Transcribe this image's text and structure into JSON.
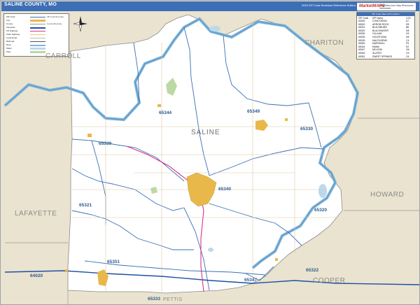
{
  "header": {
    "title": "SALINE COUNTY, MO",
    "edition": "2020 ZIP Code Business Reference Edition",
    "brand": "MarketMAPS",
    "brand_sub": "MapSales.com Map Resources Worldwide"
  },
  "legend": {
    "rows": [
      {
        "label": "ZIP Code",
        "color": "#3a70b3",
        "note": "ZIP Code Boundary"
      },
      {
        "label": "City",
        "color": "#e8b84a",
        "note": ""
      },
      {
        "label": "County",
        "color": "#999999",
        "note": "County Boundary"
      },
      {
        "label": "Interstate",
        "color": "#1f4fa5",
        "note": ""
      },
      {
        "label": "US Highway",
        "color": "#d6338f",
        "note": ""
      },
      {
        "label": "State Highway",
        "color": "#f0c27a",
        "note": ""
      },
      {
        "label": "Local Road",
        "color": "#bbbbbb",
        "note": ""
      },
      {
        "label": "Railroad",
        "color": "#555555",
        "note": ""
      },
      {
        "label": "River",
        "color": "#7fb4d9",
        "note": ""
      },
      {
        "label": "Water",
        "color": "#bcd8ec",
        "note": ""
      },
      {
        "label": "Park",
        "color": "#bcd9a3",
        "note": ""
      }
    ]
  },
  "zip_index": {
    "title": "ZIP Code Index with Location",
    "headers": {
      "code": "ZIP Code",
      "name": "ZIP Name",
      "loc": "LOC"
    },
    "rows": [
      {
        "code": "64020",
        "name": "CONCORDIA",
        "loc": "A7"
      },
      {
        "code": "65320",
        "name": "ARROW ROCK",
        "loc": "H5"
      },
      {
        "code": "65321",
        "name": "BLACKBURN",
        "loc": "B6"
      },
      {
        "code": "65322",
        "name": "BLACKWATER",
        "loc": "H8"
      },
      {
        "code": "65330",
        "name": "GILLIAM",
        "loc": "H3"
      },
      {
        "code": "65333",
        "name": "HOUSTONIA",
        "loc": "D8"
      },
      {
        "code": "65339",
        "name": "MALTA BEND",
        "loc": "C4"
      },
      {
        "code": "65340",
        "name": "MARSHALL",
        "loc": "F5"
      },
      {
        "code": "65344",
        "name": "MIAMI",
        "loc": "E2"
      },
      {
        "code": "65347",
        "name": "NELSON",
        "loc": "G6"
      },
      {
        "code": "65349",
        "name": "SLATER",
        "loc": "G3"
      },
      {
        "code": "65351",
        "name": "SWEET SPRINGS",
        "loc": "C6"
      }
    ]
  },
  "counties": {
    "center": "SALINE",
    "carroll": "CARROLL",
    "chariton": "CHARITON",
    "howard": "HOWARD",
    "lafayette": "LAFAYETTE",
    "cooper": "COOPER",
    "pettis": "PETTIS"
  },
  "zips": {
    "z65344": "65344",
    "z65349": "65349",
    "z65330": "65330",
    "z65339": "65339",
    "z65340": "65340",
    "z65321": "65321",
    "z65320": "65320",
    "z65351": "65351",
    "z65347": "65347",
    "z64020": "64020",
    "z65322": "65322",
    "z65333": "65333"
  },
  "colors": {
    "county_fill": "#ffffff",
    "outside_fill": "#eae3cf",
    "river": "#7fb4d9",
    "zip_line": "#3a70b3",
    "interstate": "#1f4fa5",
    "us_highway": "#d6338f",
    "city": "#e8b84a"
  }
}
